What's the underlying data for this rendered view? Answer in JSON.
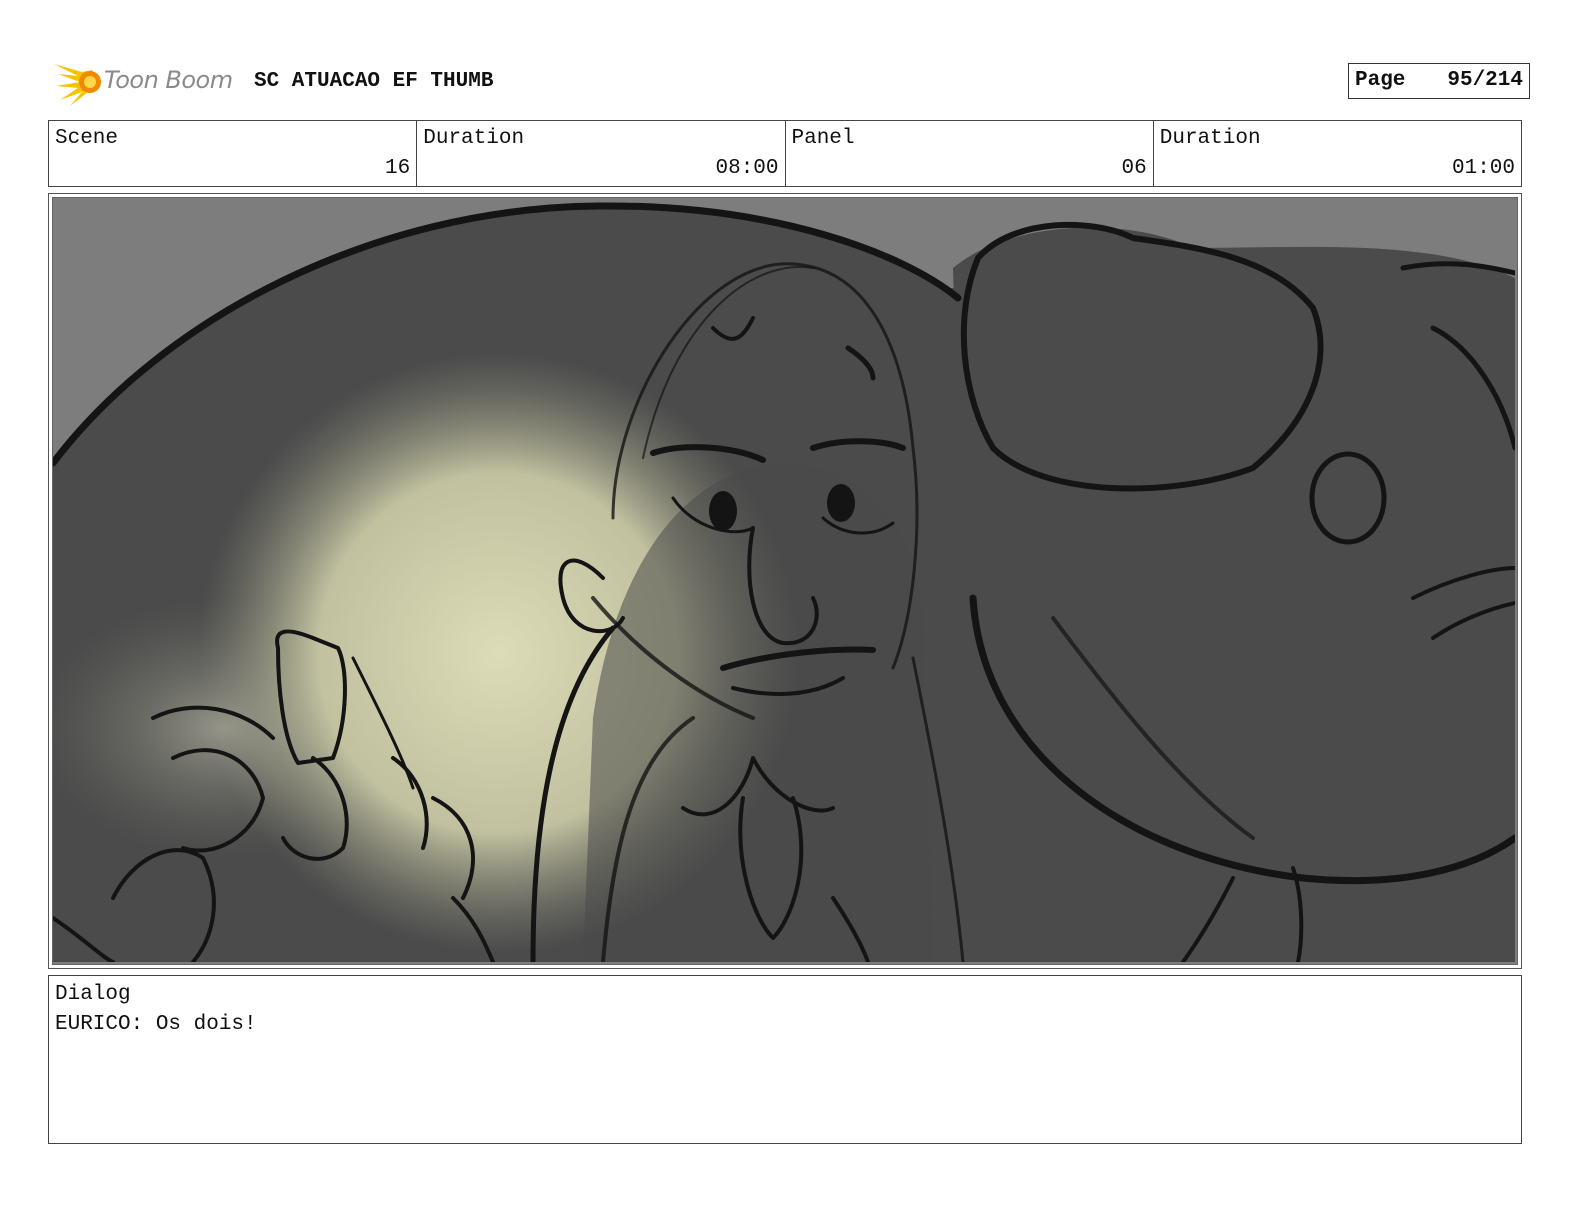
{
  "header": {
    "logo_text": "Toon Boom",
    "title": "SC ATUACAO EF THUMB",
    "page_label": "Page",
    "page_value": "95/214"
  },
  "info": {
    "scene_label": "Scene",
    "scene_value": "16",
    "scene_duration_label": "Duration",
    "scene_duration_value": "08:00",
    "panel_label": "Panel",
    "panel_value": "06",
    "panel_duration_label": "Duration",
    "panel_duration_value": "01:00"
  },
  "dialog": {
    "label": "Dialog",
    "text": "EURICO: Os dois!"
  },
  "colors": {
    "logo_yellow": "#f5c400",
    "logo_orange": "#f08a00",
    "panel_bg": "#7d7d7d",
    "shape_dark": "#4b4b4b",
    "glow": "#d8d8b0",
    "ink": "#141414"
  }
}
